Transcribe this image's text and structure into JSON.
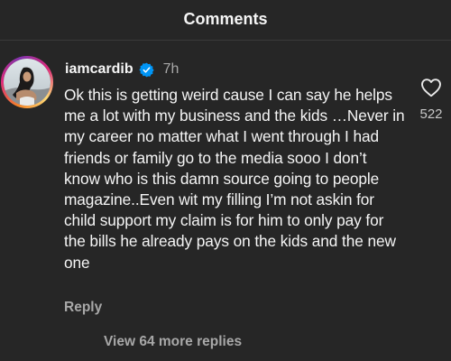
{
  "header": {
    "title": "Comments"
  },
  "comment": {
    "username": "iamcardib",
    "verified_icon": "verified-badge-icon",
    "time": "7h",
    "text": "Ok this is getting weird cause I can say he helps me a lot with my business and the kids …Never in my career no matter what I went through I had friends or family go to the media sooo I don’t know who is this damn source going to people magazine..Even wit my filling I’m not askin for child support my claim is for him to only pay for the bills he already pays on the kids and the new one",
    "like_icon": "heart-icon",
    "like_count": "522",
    "reply_label": "Reply",
    "view_replies_label": "View 64 more replies"
  },
  "colors": {
    "background": "#262626",
    "text_primary": "#f5f5f5",
    "text_secondary": "#a8a8a8",
    "verified_blue": "#0095f6"
  }
}
